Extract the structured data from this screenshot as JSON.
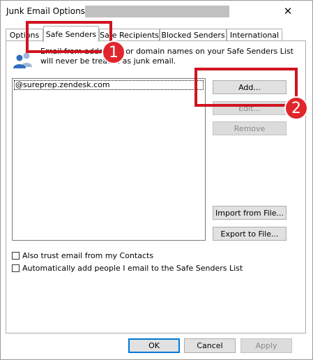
{
  "window": {
    "title": "Junk Email Options -",
    "close_glyph": "✕"
  },
  "tabs": [
    {
      "label": "Options"
    },
    {
      "label": "Safe Senders"
    },
    {
      "label": "Safe Recipients"
    },
    {
      "label": "Blocked Senders"
    },
    {
      "label": "International"
    }
  ],
  "selected_tab": "Safe Senders",
  "description": "Email from addresses or domain names on your Safe Senders List will never be treated as junk email.",
  "icon": "people-icon",
  "safe_senders_list": [
    "@sureprep.zendesk.com"
  ],
  "buttons": {
    "add": "Add...",
    "edit": "Edit...",
    "remove": "Remove",
    "import": "Import from File...",
    "export": "Export to File..."
  },
  "checkboxes": [
    {
      "label": "Also trust email from my Contacts",
      "checked": false
    },
    {
      "label": "Automatically add people I email to the Safe Senders List",
      "checked": false
    }
  ],
  "footer": {
    "ok": "OK",
    "cancel": "Cancel",
    "apply": "Apply"
  },
  "annotations": [
    {
      "number": "1",
      "target": "Safe Senders tab"
    },
    {
      "number": "2",
      "target": "Add button"
    }
  ],
  "colors": {
    "annotation_red": "#d0141f",
    "default_button_border": "#0078d7",
    "redaction_gray": "#c0c0c0"
  }
}
